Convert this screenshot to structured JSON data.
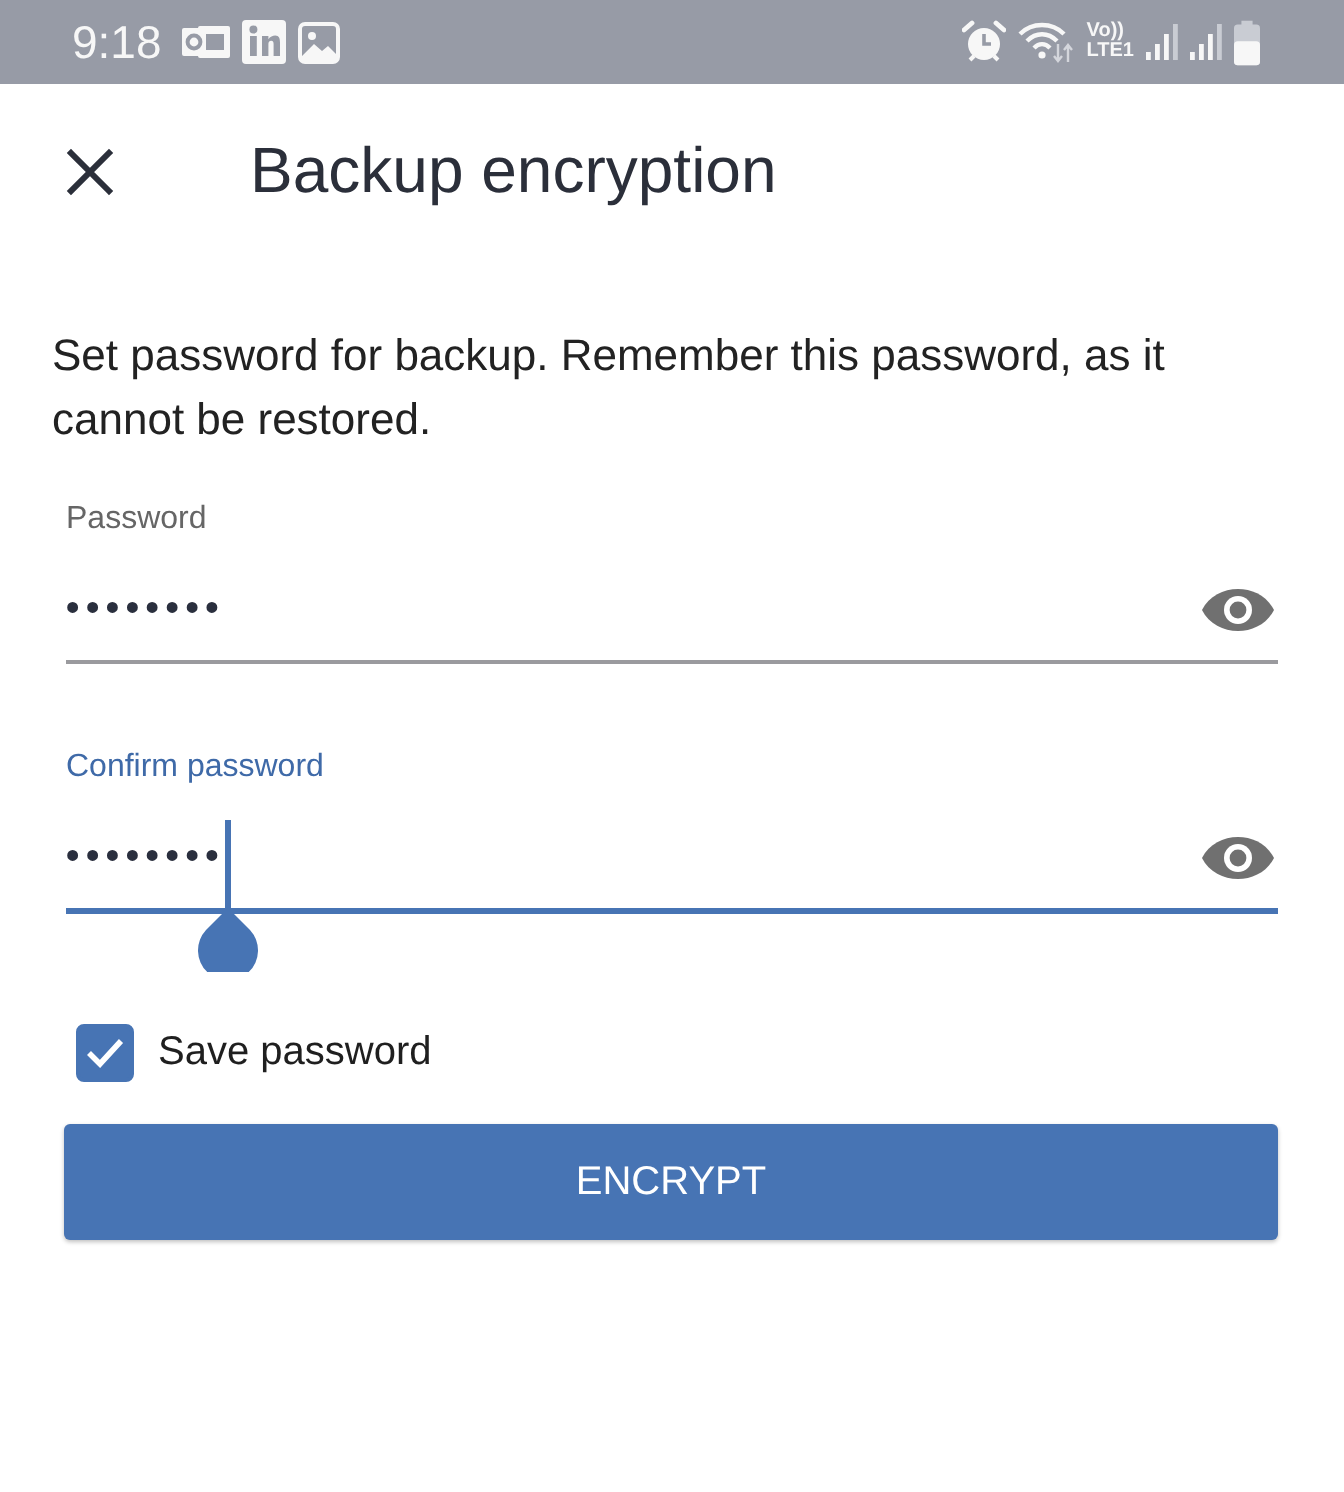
{
  "status_bar": {
    "time": "9:18",
    "network_top": "Vo))",
    "network_bottom": "LTE1"
  },
  "header": {
    "title": "Backup encryption"
  },
  "description": "Set password for backup. Remember this password, as it cannot be restored.",
  "fields": [
    {
      "label": "Password",
      "value": "••••••••",
      "focused": false
    },
    {
      "label": "Confirm password",
      "value": "••••••••",
      "focused": true
    }
  ],
  "save_password": {
    "label": "Save password",
    "checked": true
  },
  "buttons": [
    {
      "label": "ENCRYPT"
    }
  ]
}
